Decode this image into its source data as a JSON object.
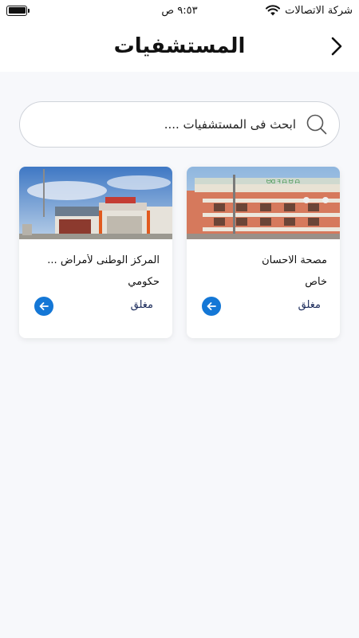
{
  "status_bar": {
    "carrier": "شركة الاتصالات",
    "time": "٩:٥٣ ص",
    "icons": [
      "wifi-icon",
      "battery-icon"
    ]
  },
  "header": {
    "title": "المستشفيات",
    "back_icon": "chevron-right-icon"
  },
  "search": {
    "placeholder": "ابحث فى المستشفيات ....",
    "value": "",
    "icon": "search-icon"
  },
  "hospitals": [
    {
      "name": "مصحة الاحسان",
      "type": "خاص",
      "status": "مغلق",
      "action_icon": "arrow-left-icon"
    },
    {
      "name": "المركز الوطنى لأمراض ...",
      "type": "حكومي",
      "status": "مغلق",
      "action_icon": "arrow-left-icon"
    }
  ],
  "colors": {
    "accent": "#1477d6",
    "background": "#f7f8fb",
    "status_text": "#1a2a5a"
  }
}
